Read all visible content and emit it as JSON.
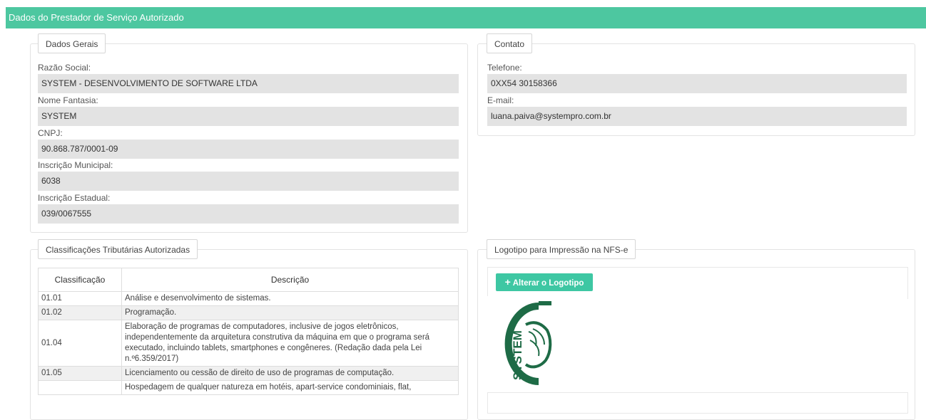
{
  "header": {
    "title": "Dados do Prestador de Serviço Autorizado"
  },
  "dados_gerais": {
    "legend": "Dados Gerais",
    "fields": [
      {
        "label": "Razão Social:",
        "value": "SYSTEM - DESENVOLVIMENTO DE SOFTWARE LTDA"
      },
      {
        "label": "Nome Fantasia:",
        "value": "SYSTEM"
      },
      {
        "label": "CNPJ:",
        "value": "90.868.787/0001-09"
      },
      {
        "label": "Inscrição Municipal:",
        "value": "6038"
      },
      {
        "label": "Inscrição Estadual:",
        "value": "039/0067555"
      }
    ]
  },
  "contato": {
    "legend": "Contato",
    "fields": [
      {
        "label": "Telefone:",
        "value": "0XX54 30158366"
      },
      {
        "label": "E-mail:",
        "value": "luana.paiva@systempro.com.br"
      }
    ]
  },
  "classificacoes": {
    "legend": "Classificações Tributárias Autorizadas",
    "columns": [
      "Classificação",
      "Descrição"
    ],
    "rows": [
      {
        "code": "01.01",
        "desc": "Análise e desenvolvimento de sistemas."
      },
      {
        "code": "01.02",
        "desc": "Programação."
      },
      {
        "code": "01.04",
        "desc": "Elaboração de programas de computadores, inclusive de jogos eletrônicos, independentemente da arquitetura construtiva da máquina em que o programa será executado, incluindo tablets, smartphones e congêneres. (Redação dada pela Lei n.º6.359/2017)"
      },
      {
        "code": "01.05",
        "desc": "Licenciamento ou cessão de direito de uso de programas de computação."
      },
      {
        "code": "",
        "desc": "Hospedagem de qualquer natureza em hotéis, apart-service condominiais, flat,"
      }
    ]
  },
  "logotipo": {
    "legend": "Logotipo para Impressão na NFS-e",
    "button_label": "Alterar o Logotipo",
    "button_icon": "plus-icon",
    "logo_text": "SYSTEM",
    "logo_color": "#1e6b46"
  },
  "colors": {
    "accent": "#4dc7a0",
    "button": "#3ec7a3",
    "field_bg": "#e3e3e3"
  }
}
